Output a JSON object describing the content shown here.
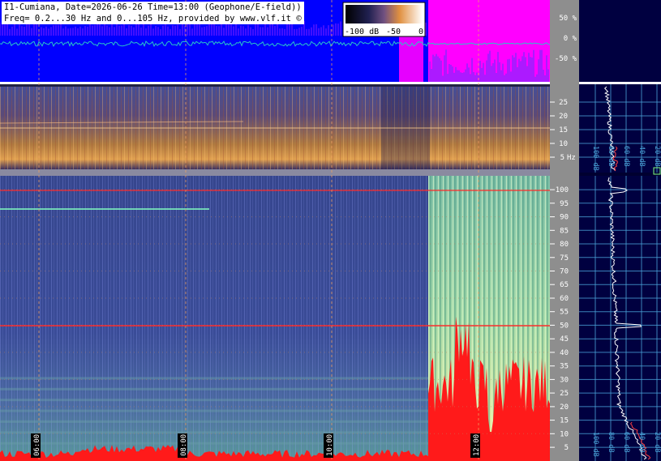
{
  "header": {
    "line1": "I1-Cumiana, Date=2026-06-26 Time=13:00 (Geophone/E-field))",
    "line2": "Freq= 0.2...30 Hz and 0...105 Hz, provided by www.vlf.it ©"
  },
  "colorbar": {
    "min_label": "-100 dB",
    "mid_label": "-50",
    "max_label": "0"
  },
  "waveform": {
    "scale_labels": [
      "50 %",
      "0 %",
      "-50 %"
    ],
    "colors": {
      "background": "#0000ff",
      "saturated": "#ff00ff",
      "trace": "#29c6c6"
    }
  },
  "elf_panel": {
    "freq_unit_label": "Hz",
    "freq_ticks": [
      25,
      20,
      15,
      10,
      5
    ],
    "spectrum_labels": [
      "100 dB",
      "80 dB",
      "60 dB",
      "40 dB",
      "20 dB"
    ]
  },
  "vlf_panel": {
    "freq_ticks": [
      100,
      95,
      90,
      85,
      80,
      75,
      70,
      65,
      60,
      55,
      50,
      45,
      40,
      35,
      30,
      25,
      20,
      15,
      10,
      5
    ],
    "spectrum_labels": [
      "100 dB",
      "80 dB",
      "60 dB",
      "40 dB",
      "20 dB"
    ]
  },
  "time_axis": {
    "labels": [
      "06:00",
      "08:00",
      "10:00",
      "12:00"
    ]
  },
  "colors": {
    "panel_bg": "#000040",
    "grid": "#4aa3d8",
    "scale_bg": "#8e8e8e",
    "hum_line": "#ff2a2a"
  }
}
